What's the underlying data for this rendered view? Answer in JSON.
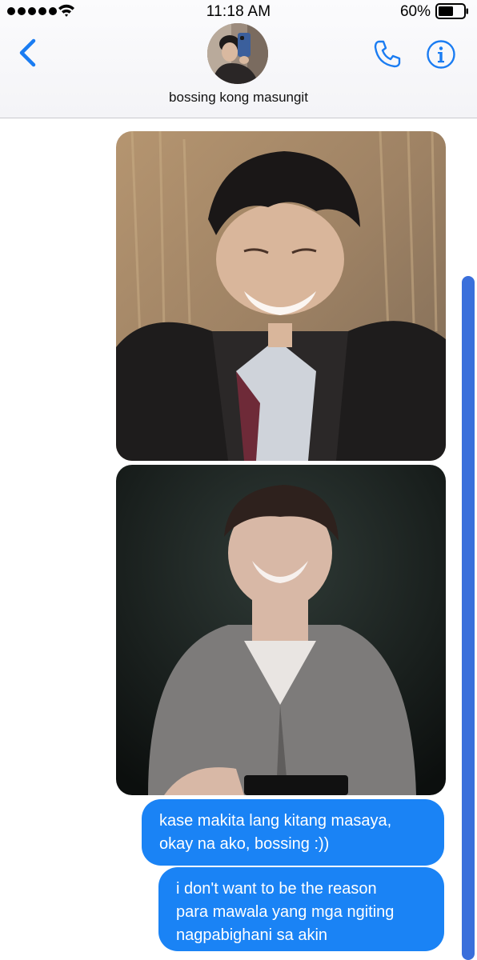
{
  "status_bar": {
    "time": "11:18 AM",
    "battery_percent": "60%",
    "battery_level": 0.6,
    "signal_bars": 5
  },
  "header": {
    "contact_name": "bossing kong masungit",
    "back_icon": "chevron-left-icon",
    "call_icon": "phone-icon",
    "info_icon": "info-icon"
  },
  "messages": [
    {
      "type": "image",
      "direction": "outgoing"
    },
    {
      "type": "image",
      "direction": "outgoing"
    },
    {
      "type": "text",
      "direction": "outgoing",
      "lines": [
        "kase makita lang kitang masaya,",
        "okay na ako, bossing :))"
      ]
    },
    {
      "type": "text",
      "direction": "outgoing",
      "lines": [
        "i don't want to be the reason",
        "para mawala yang mga ngiting",
        "nagpabighani sa akin"
      ]
    }
  ],
  "colors": {
    "accent": "#1a7cf2",
    "outgoing_bubble": "#1a83f5",
    "scrollbar": "#3a6fdb"
  }
}
